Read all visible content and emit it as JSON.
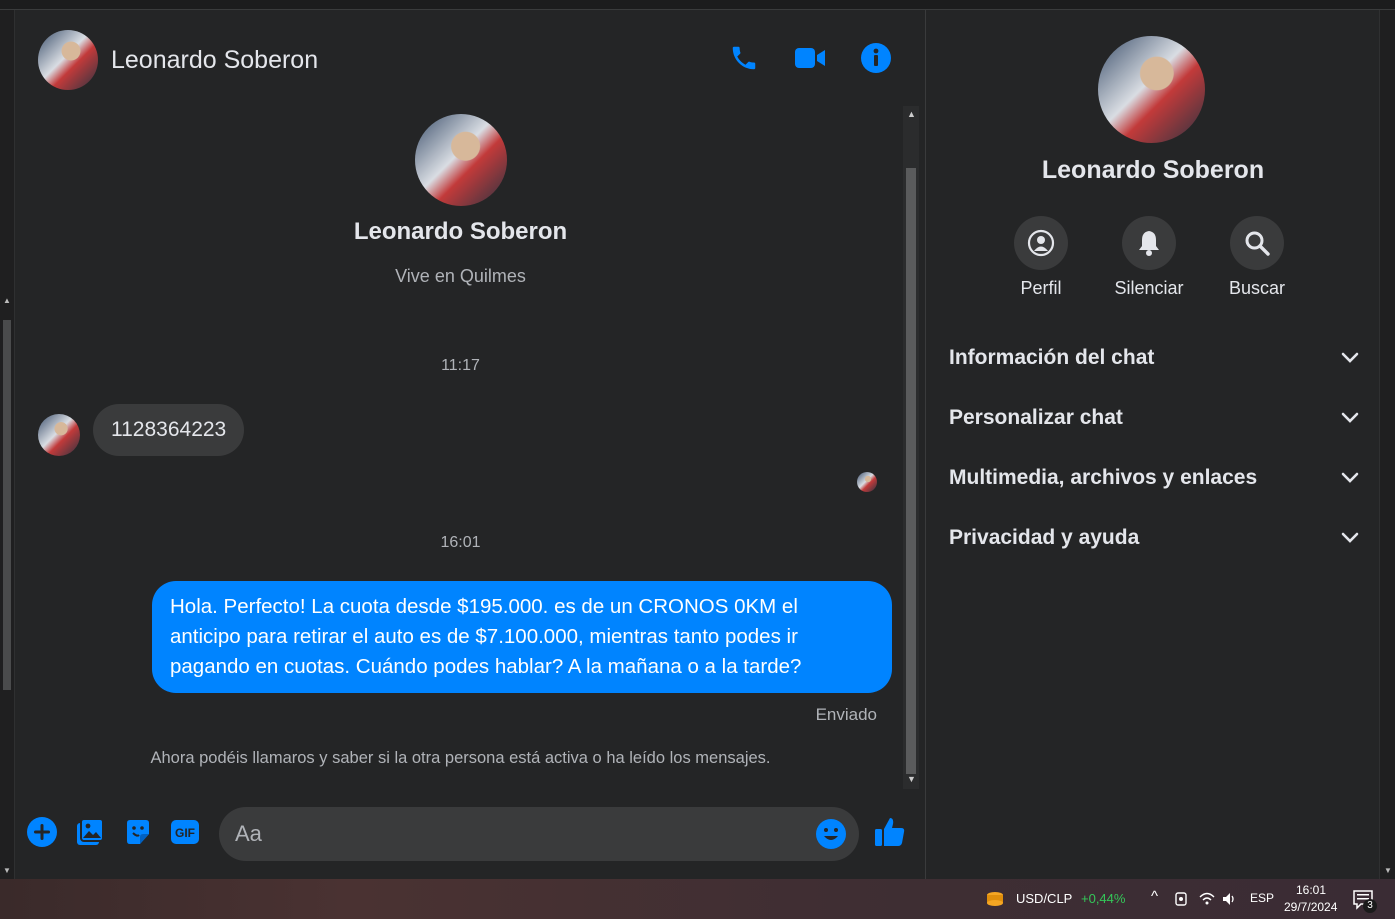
{
  "colors": {
    "accent": "#0084ff",
    "bg": "#242526",
    "bubble_in": "#3a3b3c",
    "text": "#e4e6eb",
    "muted": "#b0b3b8",
    "positive": "#34c759"
  },
  "header": {
    "name": "Leonardo Soberon",
    "icons": [
      "phone-icon",
      "video-icon",
      "info-icon"
    ]
  },
  "profile": {
    "name": "Leonardo Soberon",
    "subtitle": "Vive en Quilmes"
  },
  "messages": [
    {
      "type": "time",
      "text": "11:17"
    },
    {
      "type": "incoming",
      "text": "1128364223"
    },
    {
      "type": "time",
      "text": "16:01"
    },
    {
      "type": "outgoing",
      "text": "Hola. Perfecto! La cuota desde $195.000. es de un CRONOS 0KM el anticipo para retirar el auto es de $7.100.000, mientras tanto podes ir pagando en cuotas. Cuándo podes hablar? A la mañana o a la tarde?",
      "status": "Enviado"
    }
  ],
  "notice": "Ahora podéis llamaros y saber si la otra persona está activa o ha leído los mensajes.",
  "composer": {
    "placeholder": "Aa",
    "icons": [
      "plus-icon",
      "photo-icon",
      "sticker-icon",
      "gif-icon",
      "emoji-icon",
      "like-icon"
    ],
    "gif_label": "GIF"
  },
  "sidebar": {
    "name": "Leonardo Soberon",
    "actions": [
      {
        "label": "Perfil",
        "icon": "profile-icon"
      },
      {
        "label": "Silenciar",
        "icon": "bell-icon"
      },
      {
        "label": "Buscar",
        "icon": "search-icon"
      }
    ],
    "sections": [
      {
        "label": "Información del chat"
      },
      {
        "label": "Personalizar chat"
      },
      {
        "label": "Multimedia, archivos y enlaces"
      },
      {
        "label": "Privacidad y ayuda"
      }
    ]
  },
  "taskbar": {
    "ticker": "USD/CLP",
    "ticker_change": "+0,44%",
    "lang": "ESP",
    "time": "16:01",
    "date": "29/7/2024",
    "notifications": "3"
  }
}
